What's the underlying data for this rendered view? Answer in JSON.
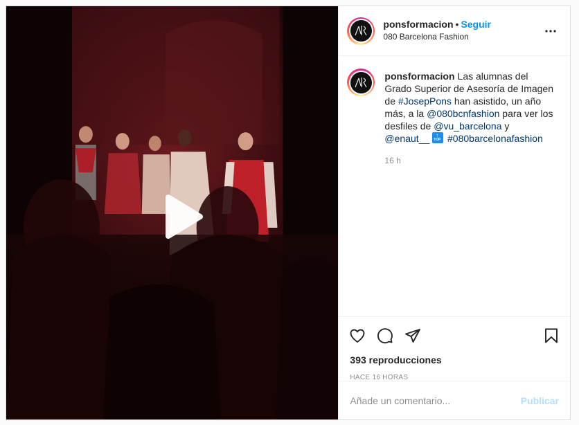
{
  "post": {
    "username": "ponsformacion",
    "follow_label": "Seguir",
    "separator": "•",
    "location": "080 Barcelona Fashion",
    "caption": {
      "username": "ponsformacion",
      "text_1": "Las alumnas del Grado Superior de Asesoría de Imagen de ",
      "tag_1": "#JosepPons",
      "text_2": " han asistido, un año más, a la ",
      "tag_2": "@080bcnfashion",
      "text_3": " para ver los desfiles de ",
      "tag_3": "@vu_barcelona",
      "text_4": " y ",
      "tag_4": "@enaut__",
      "emoji_arrow": "↑",
      "emoji_text": "TOP",
      "tag_5": "#080barcelonafashion",
      "time_ago": "16 h"
    },
    "views": "393 reproducciones",
    "timestamp": "HACE 16 HORAS",
    "comment_placeholder": "Añade un comentario...",
    "publish_label": "Publicar"
  },
  "icons": {
    "more": "more-options-icon",
    "like": "heart-icon",
    "comment": "comment-bubble-icon",
    "share": "paper-plane-icon",
    "save": "bookmark-icon",
    "play": "play-icon"
  },
  "colors": {
    "link": "#0095f6",
    "hashtag": "#00376b",
    "muted": "#8e8e8e",
    "publish_disabled": "#b2dffc"
  }
}
